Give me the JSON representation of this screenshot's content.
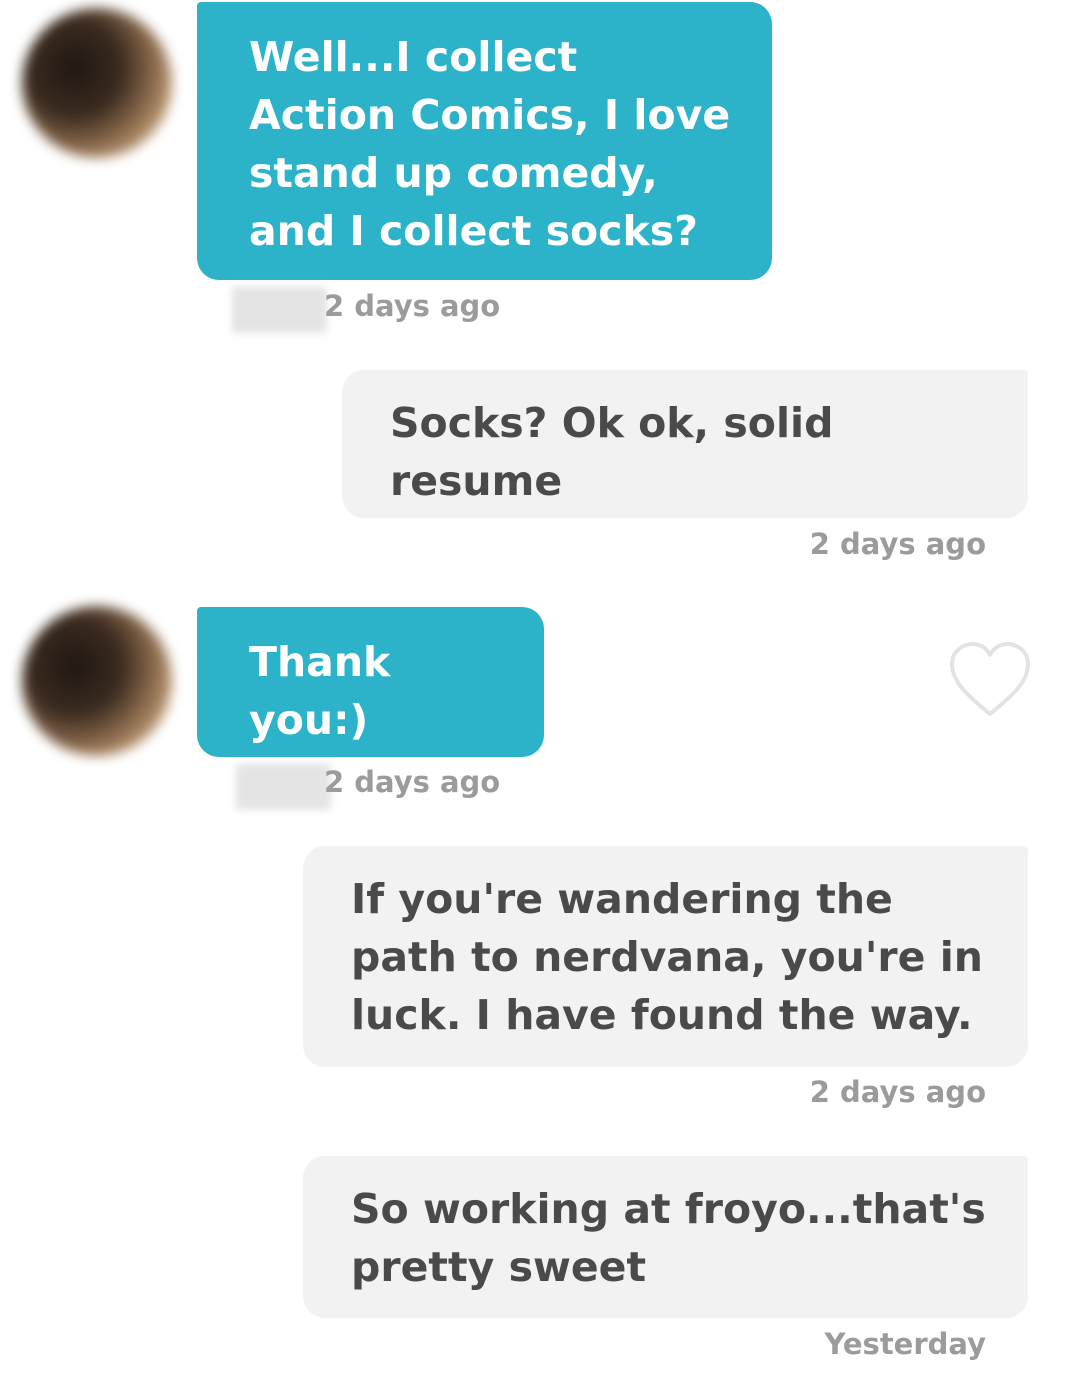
{
  "messages": [
    {
      "text": "Well...I collect Action Comics, I love stand up comedy, and I collect socks?",
      "time": "2 days ago"
    },
    {
      "text": "Socks? Ok ok, solid resume",
      "time": "2 days ago"
    },
    {
      "text": "Thank you:)",
      "time": "2 days ago"
    },
    {
      "text": "If you're wandering the path to nerdvana, you're in luck. I have found the way.",
      "time": "2 days ago"
    },
    {
      "text": "So working at froyo...that's pretty sweet",
      "time": "Yesterday"
    }
  ],
  "icons": {
    "like": "heart-outline-icon"
  },
  "colors": {
    "incoming_bubble": "#2db3c9",
    "outgoing_bubble": "#f2f2f2",
    "timestamp": "#9b9b9b"
  }
}
